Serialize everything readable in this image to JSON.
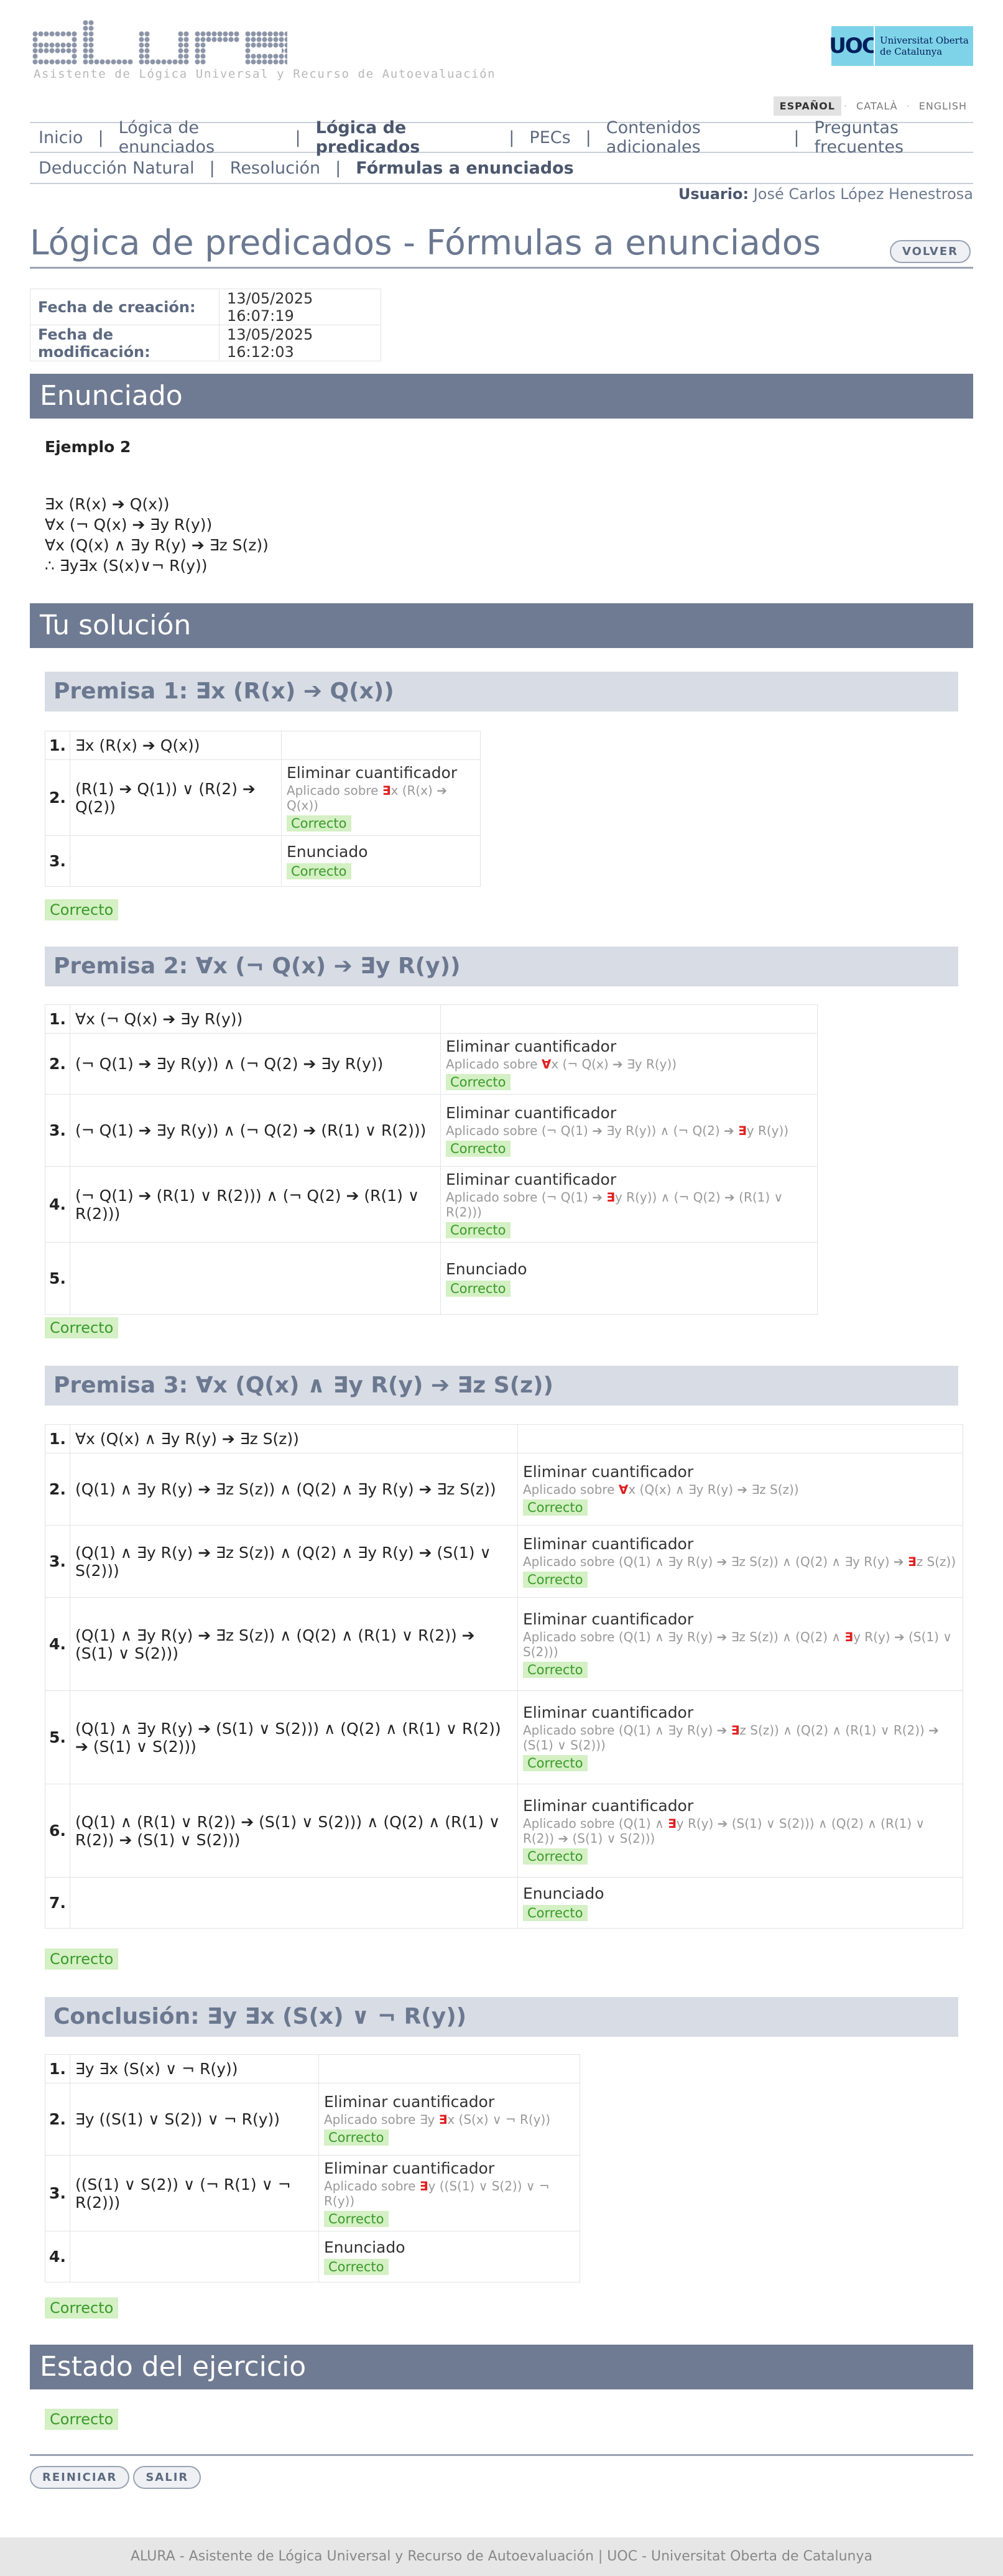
{
  "header": {
    "subtitle": "Asistente de Lógica Universal y Recurso de Autoevaluación",
    "uoc_mark": "UOC",
    "uoc_line1": "Universitat Oberta",
    "uoc_line2": "de Catalunya",
    "languages": [
      "ESPAÑOL",
      "CATALÀ",
      "ENGLISH"
    ]
  },
  "nav": {
    "items": [
      "Inicio",
      "Lógica de enunciados",
      "Lógica de predicados",
      "PECs",
      "Contenidos adicionales",
      "Preguntas frecuentes"
    ],
    "sub": [
      "Deducción Natural",
      "Resolución",
      "Fórmulas a enunciados"
    ]
  },
  "user": {
    "label": "Usuario:",
    "name": "José Carlos López Henestrosa"
  },
  "title": "Lógica de predicados - Fórmulas a enunciados",
  "volver": "VOLVER",
  "dates": {
    "created_label": "Fecha de creación:",
    "created": "13/05/2025 16:07:19",
    "modified_label": "Fecha de modificación:",
    "modified": "13/05/2025 16:12:03"
  },
  "enunciado": {
    "heading": "Enunciado",
    "name": "Ejemplo 2",
    "lines": [
      "∃x (R(x) ➔ Q(x))",
      "∀x (¬ Q(x) ➔ ∃y R(y))",
      "∀x (Q(x) ∧ ∃y R(y) ➔ ∃z S(z))",
      "∴ ∃y∃x (S(x)∨¬ R(y))"
    ]
  },
  "solucion": {
    "heading": "Tu solución"
  },
  "labels": {
    "correcto": "Correcto",
    "applied": "Aplicado sobre"
  },
  "premisas": [
    {
      "title": "Premisa 1: ∃x (R(x) ➔ Q(x))",
      "rows": [
        {
          "n": "1.",
          "f": "∃x (R(x) ➔ Q(x))",
          "rule": "",
          "a_pre": "",
          "a_hl": "",
          "a_post": "",
          "ok": false
        },
        {
          "n": "2.",
          "f": "(R(1) ➔ Q(1)) ∨ (R(2) ➔ Q(2))",
          "rule": "Eliminar cuantificador",
          "a_pre": "",
          "a_hl": "∃",
          "a_post": "x (R(x) ➔ Q(x))",
          "ok": true
        },
        {
          "n": "3.",
          "f": "",
          "rule": "Enunciado",
          "a_pre": "",
          "a_hl": "",
          "a_post": "",
          "ok": true
        }
      ]
    },
    {
      "title": "Premisa 2: ∀x (¬ Q(x) ➔ ∃y R(y))",
      "rows": [
        {
          "n": "1.",
          "f": "∀x (¬ Q(x) ➔ ∃y R(y))",
          "rule": "",
          "a_pre": "",
          "a_hl": "",
          "a_post": "",
          "ok": false
        },
        {
          "n": "2.",
          "f": "(¬ Q(1) ➔ ∃y R(y)) ∧ (¬ Q(2) ➔ ∃y R(y))",
          "rule": "Eliminar cuantificador",
          "a_pre": "",
          "a_hl": "∀",
          "a_post": "x (¬ Q(x) ➔ ∃y R(y))",
          "ok": true
        },
        {
          "n": "3.",
          "f": "(¬ Q(1) ➔ ∃y R(y)) ∧ (¬ Q(2) ➔ (R(1) ∨ R(2)))",
          "rule": "Eliminar cuantificador",
          "a_pre": "(¬ Q(1) ➔ ∃y R(y)) ∧ (¬ Q(2) ➔ ",
          "a_hl": "∃",
          "a_post": "y R(y))",
          "ok": true
        },
        {
          "n": "4.",
          "f": "(¬ Q(1) ➔ (R(1) ∨ R(2))) ∧ (¬ Q(2) ➔ (R(1) ∨ R(2)))",
          "rule": "Eliminar cuantificador",
          "a_pre": "(¬ Q(1) ➔ ",
          "a_hl": "∃",
          "a_post": "y R(y)) ∧ (¬ Q(2) ➔ (R(1) ∨ R(2)))",
          "ok": true
        },
        {
          "n": "5.",
          "f": "",
          "rule": "Enunciado",
          "a_pre": "",
          "a_hl": "",
          "a_post": "",
          "ok": true
        }
      ]
    },
    {
      "title": "Premisa 3: ∀x (Q(x) ∧ ∃y R(y) ➔ ∃z S(z))",
      "rows": [
        {
          "n": "1.",
          "f": "∀x (Q(x) ∧ ∃y R(y) ➔ ∃z S(z))",
          "rule": "",
          "a_pre": "",
          "a_hl": "",
          "a_post": "",
          "ok": false
        },
        {
          "n": "2.",
          "f": "(Q(1) ∧ ∃y R(y) ➔ ∃z S(z)) ∧ (Q(2) ∧ ∃y R(y) ➔ ∃z S(z))",
          "rule": "Eliminar cuantificador",
          "a_pre": "",
          "a_hl": "∀",
          "a_post": "x (Q(x) ∧ ∃y R(y) ➔ ∃z S(z))",
          "ok": true
        },
        {
          "n": "3.",
          "f": "(Q(1) ∧ ∃y R(y) ➔ ∃z S(z)) ∧ (Q(2) ∧ ∃y R(y) ➔ (S(1) ∨ S(2)))",
          "rule": "Eliminar cuantificador",
          "a_pre": "(Q(1) ∧ ∃y R(y) ➔ ∃z S(z)) ∧ (Q(2) ∧ ∃y R(y) ➔ ",
          "a_hl": "∃",
          "a_post": "z S(z))",
          "ok": true
        },
        {
          "n": "4.",
          "f": "(Q(1) ∧ ∃y R(y) ➔ ∃z S(z)) ∧ (Q(2) ∧ (R(1) ∨ R(2)) ➔ (S(1) ∨ S(2)))",
          "rule": "Eliminar cuantificador",
          "a_pre": "(Q(1) ∧ ∃y R(y) ➔ ∃z S(z)) ∧ (Q(2) ∧ ",
          "a_hl": "∃",
          "a_post": "y R(y) ➔ (S(1) ∨ S(2)))",
          "ok": true
        },
        {
          "n": "5.",
          "f": "(Q(1) ∧ ∃y R(y) ➔ (S(1) ∨ S(2))) ∧ (Q(2) ∧ (R(1) ∨ R(2)) ➔ (S(1) ∨ S(2)))",
          "rule": "Eliminar cuantificador",
          "a_pre": "(Q(1) ∧ ∃y R(y) ➔ ",
          "a_hl": "∃",
          "a_post": "z S(z)) ∧ (Q(2) ∧ (R(1) ∨ R(2)) ➔ (S(1) ∨ S(2)))",
          "ok": true
        },
        {
          "n": "6.",
          "f": "(Q(1) ∧ (R(1) ∨ R(2)) ➔ (S(1) ∨ S(2))) ∧ (Q(2) ∧ (R(1) ∨ R(2)) ➔ (S(1) ∨ S(2)))",
          "rule": "Eliminar cuantificador",
          "a_pre": "(Q(1) ∧ ",
          "a_hl": "∃",
          "a_post": "y R(y) ➔ (S(1) ∨ S(2))) ∧ (Q(2) ∧ (R(1) ∨ R(2)) ➔ (S(1) ∨ S(2)))",
          "ok": true
        },
        {
          "n": "7.",
          "f": "",
          "rule": "Enunciado",
          "a_pre": "",
          "a_hl": "",
          "a_post": "",
          "ok": true
        }
      ]
    },
    {
      "title": "Conclusión: ∃y ∃x (S(x) ∨ ¬ R(y))",
      "rows": [
        {
          "n": "1.",
          "f": "∃y ∃x (S(x) ∨ ¬ R(y))",
          "rule": "",
          "a_pre": "",
          "a_hl": "",
          "a_post": "",
          "ok": false
        },
        {
          "n": "2.",
          "f": "∃y ((S(1) ∨ S(2)) ∨ ¬ R(y))",
          "rule": "Eliminar cuantificador",
          "a_pre": "∃y ",
          "a_hl": "∃",
          "a_post": "x (S(x) ∨ ¬ R(y))",
          "ok": true
        },
        {
          "n": "3.",
          "f": "((S(1) ∨ S(2)) ∨ (¬ R(1) ∨ ¬ R(2)))",
          "rule": "Eliminar cuantificador",
          "a_pre": "",
          "a_hl": "∃",
          "a_post": "y ((S(1) ∨ S(2)) ∨ ¬ R(y))",
          "ok": true
        },
        {
          "n": "4.",
          "f": "",
          "rule": "Enunciado",
          "a_pre": "",
          "a_hl": "",
          "a_post": "",
          "ok": true
        }
      ]
    }
  ],
  "estado": {
    "heading": "Estado del ejercicio",
    "value": "Correcto"
  },
  "buttons": {
    "reiniciar": "REINICIAR",
    "salir": "SALIR"
  },
  "footer": "ALURA - Asistente de Lógica Universal y Recurso de Autoevaluación | UOC - Universitat Oberta de Catalunya",
  "colors": {
    "section": "#6f7b92",
    "premise_bg": "#d8dce4",
    "ok_bg": "#d4f0c4",
    "ok_text": "#3a9a2a",
    "highlight": "#e02020"
  }
}
